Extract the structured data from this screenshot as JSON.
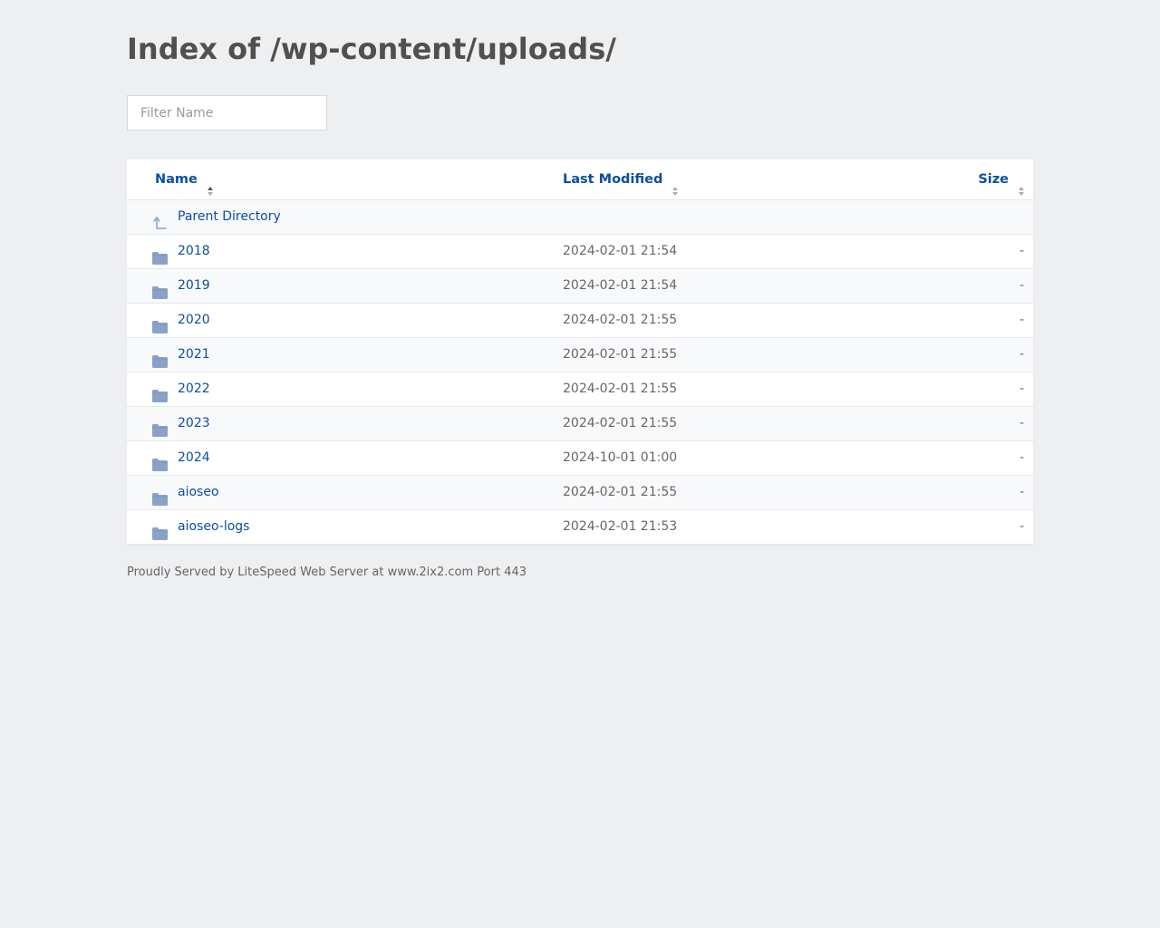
{
  "title": "Index of /wp-content/uploads/",
  "filter": {
    "placeholder": "Filter Name",
    "value": ""
  },
  "table": {
    "columns": {
      "name": "Name",
      "last_modified": "Last Modified",
      "size": "Size"
    },
    "parent": {
      "label": "Parent Directory",
      "icon": "arrow-up-icon"
    },
    "rows": [
      {
        "name": "2018",
        "modified": "2024-02-01 21:54",
        "size": "-",
        "icon": "folder-icon"
      },
      {
        "name": "2019",
        "modified": "2024-02-01 21:54",
        "size": "-",
        "icon": "folder-icon"
      },
      {
        "name": "2020",
        "modified": "2024-02-01 21:55",
        "size": "-",
        "icon": "folder-icon"
      },
      {
        "name": "2021",
        "modified": "2024-02-01 21:55",
        "size": "-",
        "icon": "folder-icon"
      },
      {
        "name": "2022",
        "modified": "2024-02-01 21:55",
        "size": "-",
        "icon": "folder-icon"
      },
      {
        "name": "2023",
        "modified": "2024-02-01 21:55",
        "size": "-",
        "icon": "folder-icon"
      },
      {
        "name": "2024",
        "modified": "2024-10-01 01:00",
        "size": "-",
        "icon": "folder-icon"
      },
      {
        "name": "aioseo",
        "modified": "2024-02-01 21:55",
        "size": "-",
        "icon": "folder-icon"
      },
      {
        "name": "aioseo-logs",
        "modified": "2024-02-01 21:53",
        "size": "-",
        "icon": "folder-icon"
      }
    ]
  },
  "footer": "Proudly Served by LiteSpeed Web Server at www.2ix2.com Port 443",
  "colors": {
    "background": "#eeeff1",
    "link": "#0b4ea2",
    "folder": "#8aa2c8",
    "text": "#555555"
  }
}
